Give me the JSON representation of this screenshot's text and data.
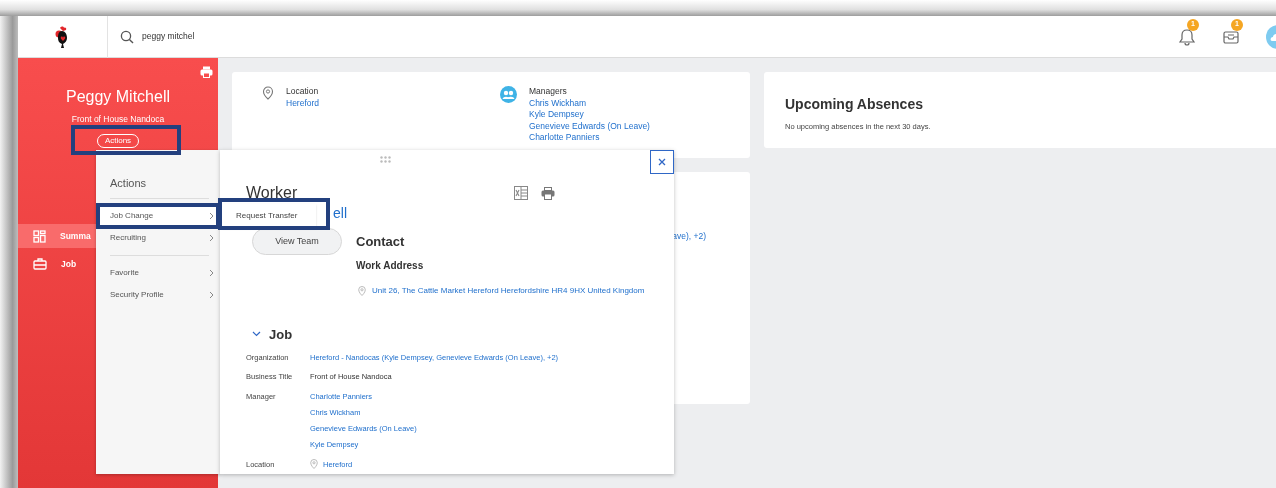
{
  "search": {
    "value": "peggy mitchel"
  },
  "notifications": [
    {
      "kind": "bell",
      "count": "1"
    },
    {
      "kind": "inbox",
      "count": "1"
    }
  ],
  "profile": {
    "name": "Peggy Mitchell",
    "title": "Front of House Nandoca",
    "actions_button": {
      "label": "Actions",
      "highlighted": true
    }
  },
  "sidebar": {
    "items": [
      {
        "kind": "summary",
        "label": "Summa",
        "selected": true
      },
      {
        "kind": "job",
        "label": "Job",
        "selected": false
      }
    ]
  },
  "location_card": {
    "label": "Location",
    "value": "Hereford"
  },
  "managers_card": {
    "label": "Managers",
    "names": [
      "Chris Wickham",
      "Kyle Dempsey",
      "Genevieve Edwards (On Leave)",
      "Charlotte Panniers"
    ]
  },
  "organization_card": {
    "fragment": "ave), +2)"
  },
  "absences_card": {
    "title": "Upcoming Absences",
    "message": "No upcoming absences in the next 30 days."
  },
  "actions_menu": {
    "title": "Actions",
    "groups": [
      [
        {
          "label": "Job Change",
          "highlighted": true
        },
        {
          "label": "Recruiting",
          "highlighted": false
        }
      ],
      [
        {
          "label": "Favorite",
          "highlighted": false
        },
        {
          "label": "Security Profile",
          "highlighted": false
        }
      ]
    ]
  },
  "submenu": {
    "items": [
      {
        "label": "Request Transfer",
        "highlighted": true
      }
    ]
  },
  "worker_popup": {
    "title": "Worker",
    "link_fragment": "ell",
    "view_team": "View Team",
    "contact": {
      "title": "Contact",
      "subtitle": "Work Address",
      "address": "Unit 26, The Cattle Market Hereford Herefordshire HR4 9HX United Kingdom"
    },
    "job": {
      "title": "Job",
      "expanded": true,
      "fields": [
        {
          "label": "Organization",
          "kind": "link",
          "values": [
            "Hereford - Nandocas (Kyle Dempsey, Genevieve Edwards (On Leave), +2)"
          ]
        },
        {
          "label": "Business Title",
          "kind": "text",
          "values": [
            "Front of House Nandoca"
          ]
        },
        {
          "label": "Manager",
          "kind": "link",
          "values": [
            "Charlotte Panniers",
            "Chris Wickham",
            "Genevieve Edwards (On Leave)",
            "Kyle Dempsey"
          ]
        },
        {
          "label": "Location",
          "kind": "location",
          "values": [
            "Hereford"
          ]
        }
      ]
    }
  }
}
